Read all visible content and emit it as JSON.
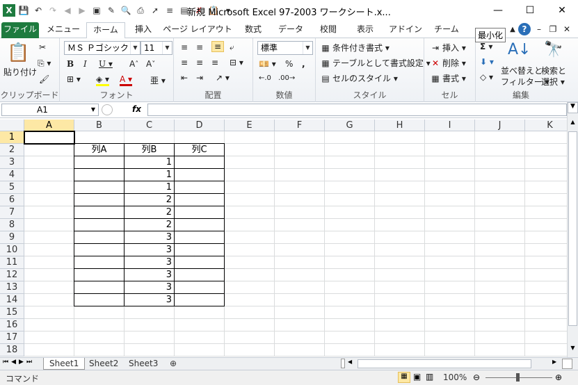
{
  "window": {
    "title": "新規 Microsoft Excel 97-2003 ワークシート.x...",
    "tooltip": "最小化"
  },
  "tabs": [
    "ファイル",
    "メニュー",
    "ホーム",
    "挿入",
    "ページ レイアウト",
    "数式",
    "データ",
    "校閲",
    "表示",
    "アドイン",
    "チーム"
  ],
  "ribbon": {
    "clipboard": {
      "label": "クリップボード",
      "paste": "貼り付け"
    },
    "font": {
      "label": "フォント",
      "name": "ＭＳ Ｐゴシック",
      "size": "11"
    },
    "alignment": {
      "label": "配置"
    },
    "number": {
      "label": "数値",
      "format": "標準"
    },
    "styles": {
      "label": "スタイル",
      "conditional": "条件付き書式",
      "table": "テーブルとして書式設定",
      "cell": "セルのスタイル"
    },
    "cells": {
      "label": "セル",
      "insert": "挿入",
      "delete": "削除",
      "format": "書式"
    },
    "editing": {
      "label": "編集",
      "sort1": "並べ替えと",
      "sort2": "フィルター",
      "find1": "検索と",
      "find2": "選択"
    }
  },
  "formula_bar": {
    "name_box": "A1",
    "fx": "fx",
    "value": ""
  },
  "columns": [
    "A",
    "B",
    "C",
    "D",
    "E",
    "F",
    "G",
    "H",
    "I",
    "J",
    "K"
  ],
  "rows": [
    "1",
    "2",
    "3",
    "4",
    "5",
    "6",
    "7",
    "8",
    "9",
    "10",
    "11",
    "12",
    "13",
    "14",
    "15",
    "16",
    "17",
    "18"
  ],
  "table": {
    "headers": [
      "列A",
      "列B",
      "列C"
    ],
    "values": [
      "1",
      "1",
      "1",
      "2",
      "2",
      "2",
      "3",
      "3",
      "3",
      "3",
      "3",
      "3"
    ]
  },
  "sheets": [
    "Sheet1",
    "Sheet2",
    "Sheet3"
  ],
  "status": {
    "mode": "コマンド",
    "zoom": "100%"
  },
  "colors": {
    "file_tab": "#1e7b3f",
    "selected_header": "#fde8a5",
    "ribbon_bg": "#eef1f5"
  }
}
